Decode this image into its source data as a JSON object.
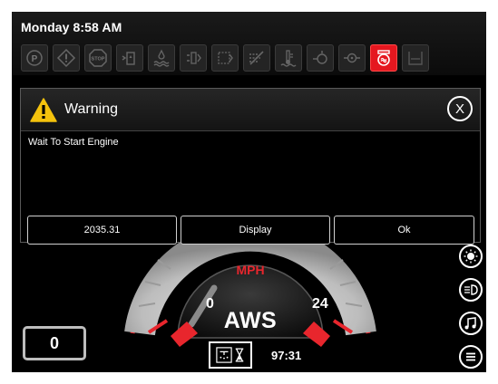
{
  "status": {
    "clock": "Monday 8:58 AM",
    "indicators": [
      {
        "icon": "park-icon",
        "text": "(P)",
        "active": false
      },
      {
        "icon": "warning-diamond-icon",
        "text": "!",
        "active": false
      },
      {
        "icon": "stop-icon",
        "text": "STOP",
        "active": false
      },
      {
        "icon": "fuel-filter-icon",
        "text": "",
        "active": false
      },
      {
        "icon": "coolant-level-icon",
        "text": "",
        "active": false
      },
      {
        "icon": "hydraulic-icon",
        "text": "",
        "active": false
      },
      {
        "icon": "hydraulic-filter-icon",
        "text": "",
        "active": false
      },
      {
        "icon": "air-filter-icon",
        "text": "",
        "active": false
      },
      {
        "icon": "coolant-temp-icon",
        "text": "",
        "active": false
      },
      {
        "icon": "oil-icon",
        "text": "",
        "active": false
      },
      {
        "icon": "engine-oil-icon",
        "text": "",
        "active": false
      },
      {
        "icon": "wait-to-start-icon",
        "text": "",
        "active": true
      },
      {
        "icon": "def-icon",
        "text": "",
        "active": false
      }
    ]
  },
  "dialog": {
    "title": "Warning",
    "close_label": "X",
    "message": "Wait To Start Engine",
    "buttons": [
      "2035.31",
      "Display",
      "Ok"
    ]
  },
  "gauge": {
    "unit": "MPH",
    "min_label": "0",
    "max_label": "24",
    "mode": "AWS",
    "accent_color": "#e8262d"
  },
  "footer": {
    "counter_value": "0",
    "timer_value": "97:31"
  },
  "side_buttons": [
    "brightness-icon",
    "headlight-icon",
    "music-icon",
    "menu-icon"
  ]
}
